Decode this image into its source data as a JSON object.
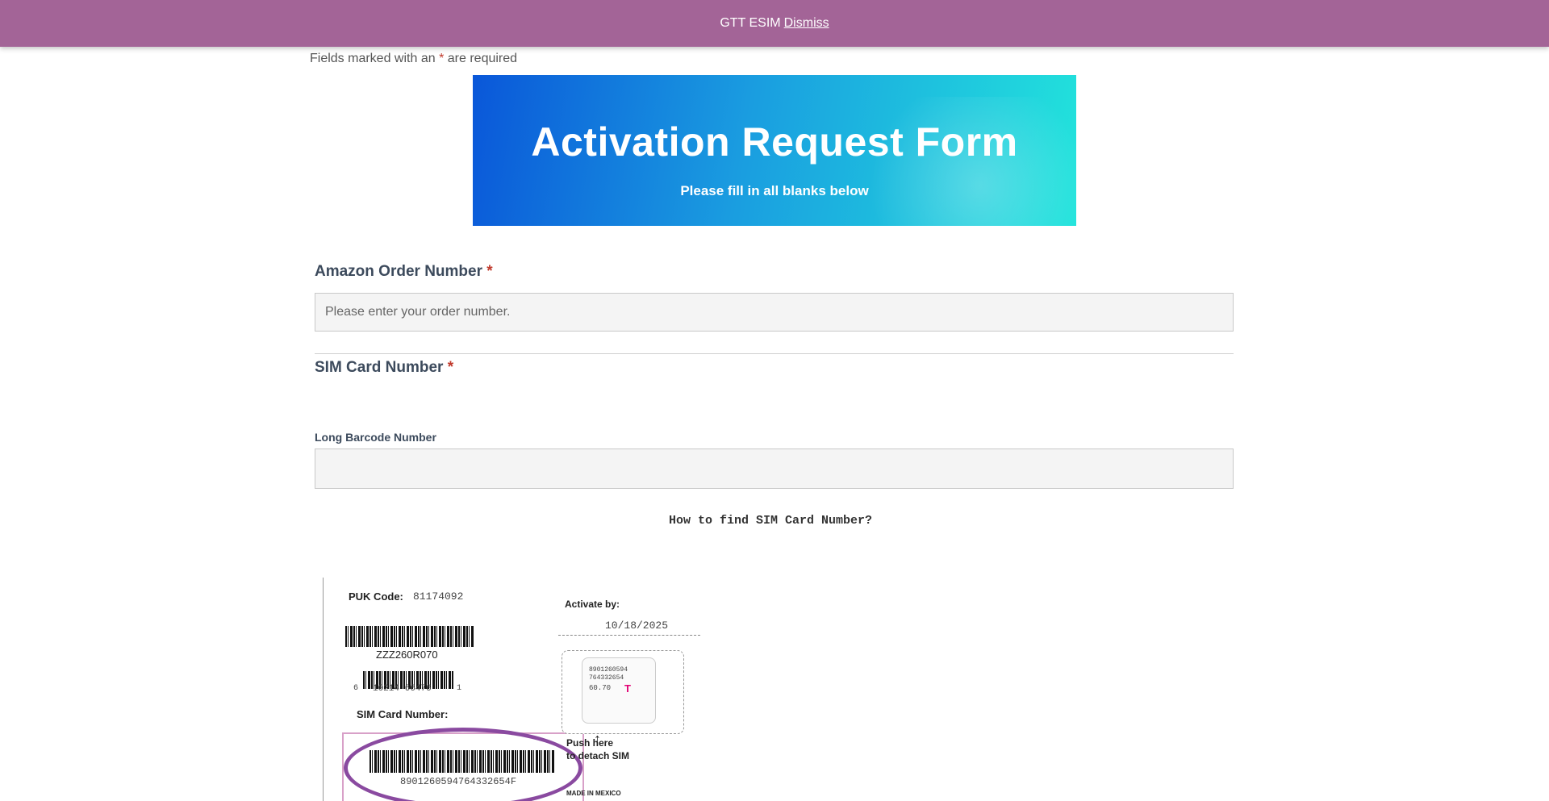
{
  "topbar": {
    "text": "GTT ESIM",
    "dismiss": "Dismiss"
  },
  "form": {
    "required_note_prefix": "Fields marked with an",
    "required_star": "*",
    "required_note_suffix": "are required",
    "banner": {
      "title": "Activation Request Form",
      "subtitle": "Please fill in all blanks below"
    },
    "order_field": {
      "label": "Amazon Order Number",
      "star": "*",
      "placeholder": "Please enter your order number.",
      "value": ""
    },
    "sim_field": {
      "label": "SIM Card Number",
      "star": "*"
    },
    "barcode_field": {
      "label": "Long Barcode Number",
      "placeholder": "",
      "value": ""
    },
    "howto": "How to find SIM Card Number?"
  },
  "sim_image": {
    "puk_label": "PUK Code:",
    "puk_value": "81174092",
    "code1": "ZZZ260R070",
    "upc_left": "6",
    "upc_mid": "10214 66476",
    "upc_right": "1",
    "sim_label": "SIM Card Number:",
    "sim_number": "8901260594764332654F",
    "activate_label": "Activate by:",
    "activate_date": "10/18/2025",
    "chip_line1": "8901260594",
    "chip_line2": "764332654",
    "chip_line3": "60.70",
    "push_line1": "Push here",
    "push_line2": "to detach SIM",
    "made_in": "MADE IN MEXICO"
  }
}
